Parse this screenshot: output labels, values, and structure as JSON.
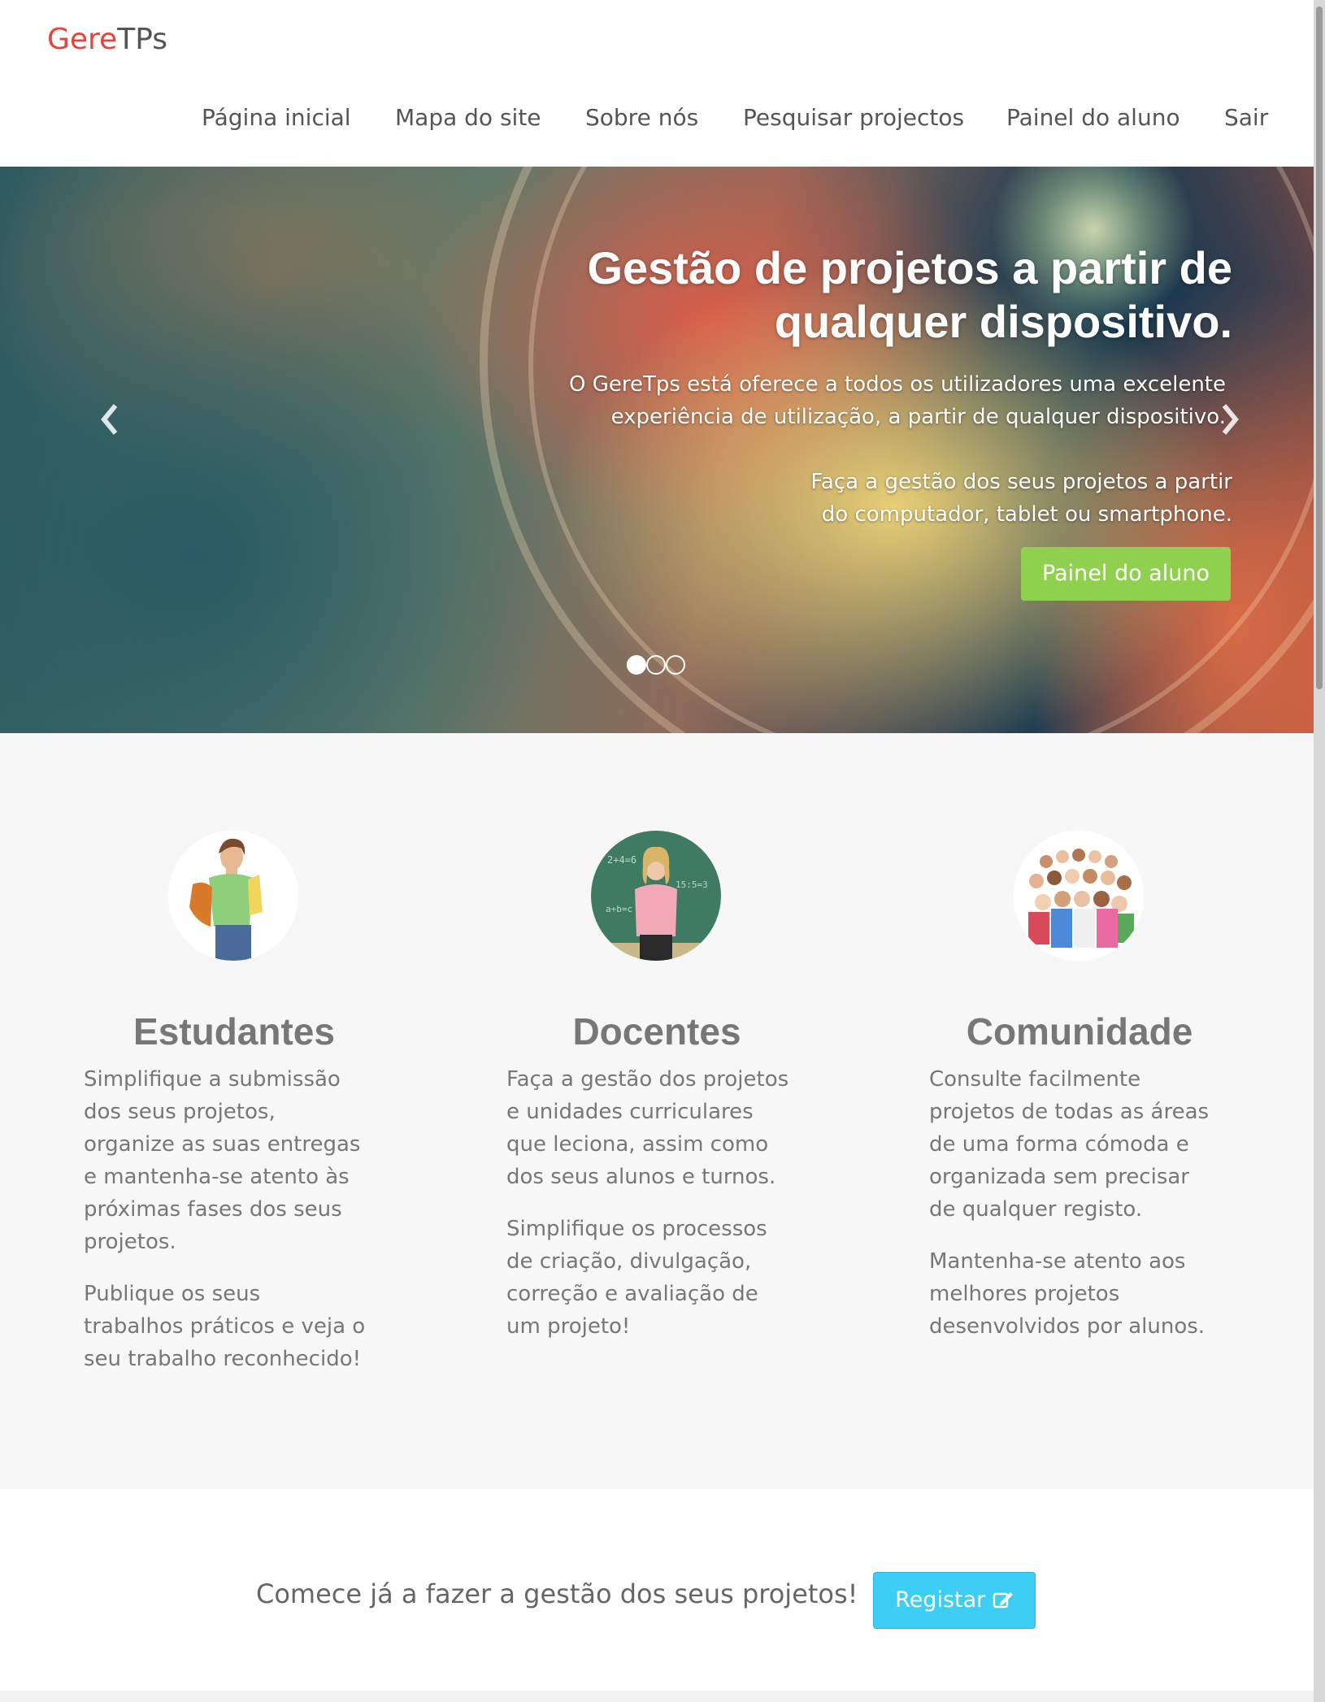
{
  "header": {
    "logo_red": "Gere",
    "logo_rest": "TPs",
    "nav": [
      {
        "label": "Página inicial"
      },
      {
        "label": "Mapa do site"
      },
      {
        "label": "Sobre nós"
      },
      {
        "label": "Pesquisar projectos"
      },
      {
        "label": "Painel do aluno"
      },
      {
        "label": "Sair"
      }
    ]
  },
  "hero": {
    "title_line1": "Gestão de projetos a partir de",
    "title_line2": "qualquer dispositivo.",
    "text1_line1": "O GereTps está oferece a todos os utilizadores uma excelente",
    "text1_line2": "experiência de utilização, a partir de qualquer dispositivo.",
    "text2_line1": "Faça a gestão dos seus projetos a partir",
    "text2_line2": "do computador, tablet ou smartphone.",
    "button_label": "Painel do aluno",
    "prev_icon": "chevron-left-icon",
    "next_icon": "chevron-right-icon",
    "slides_total": 3,
    "active_slide": 1
  },
  "features": [
    {
      "title": "Estudantes",
      "image": "student-photo",
      "paragraphs": [
        [
          "Simplifique a submissão",
          "dos seus projetos,",
          "organize as suas entregas",
          "e mantenha-se atento às",
          "próximas fases dos seus",
          "projetos."
        ],
        [
          "Publique os seus",
          "trabalhos práticos e veja o",
          "seu trabalho reconhecido!"
        ]
      ]
    },
    {
      "title": "Docentes",
      "image": "teacher-photo",
      "paragraphs": [
        [
          "Faça a gestão dos projetos",
          "e unidades curriculares",
          "que leciona, assim como",
          "dos seus alunos e turnos."
        ],
        [
          "Simplifique os processos",
          "de criação, divulgação,",
          "correção e avaliação de",
          "um projeto!"
        ]
      ]
    },
    {
      "title": "Comunidade",
      "image": "community-photo",
      "paragraphs": [
        [
          "Consulte facilmente",
          "projetos de todas as áreas",
          "de uma forma cómoda e",
          "organizada sem precisar",
          "de qualquer registo."
        ],
        [
          "Mantenha-se atento aos",
          "melhores projetos",
          "desenvolvidos por alunos."
        ]
      ]
    }
  ],
  "cta": {
    "text": "Comece já a fazer a gestão dos seus projetos!",
    "button_label": "Registar",
    "button_icon": "edit-icon"
  },
  "colors": {
    "logo_accent": "#e8443a",
    "hero_button": "#8fd14f",
    "cta_button": "#3ecdf5"
  }
}
